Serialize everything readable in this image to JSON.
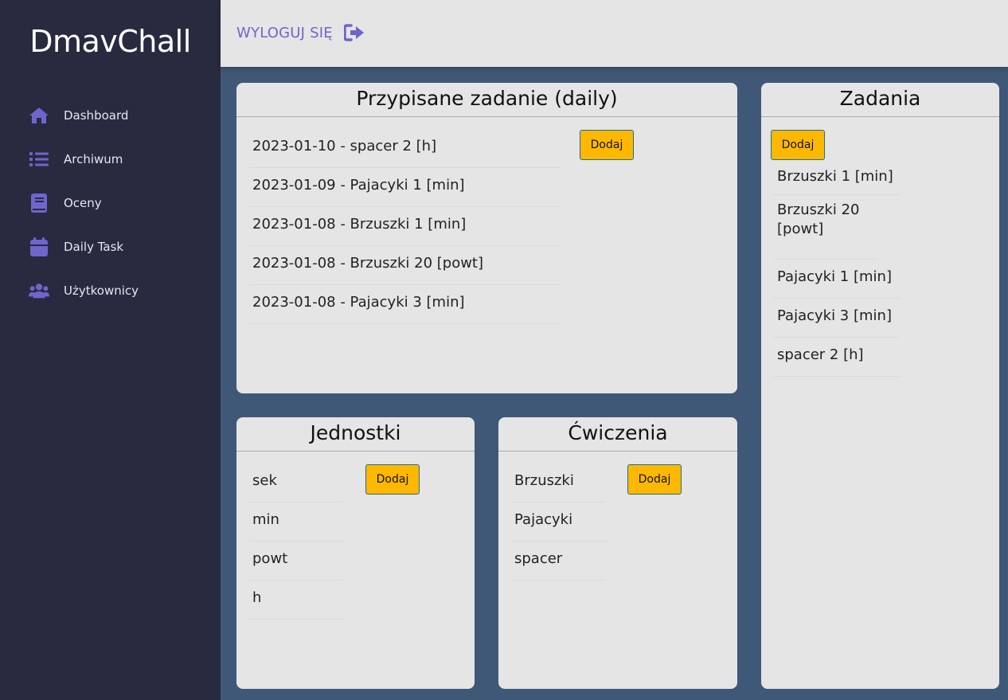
{
  "app": {
    "brand": "DmavChall"
  },
  "sidebar": {
    "items": [
      {
        "label": "Dashboard",
        "icon": "home-icon"
      },
      {
        "label": "Archiwum",
        "icon": "list-icon"
      },
      {
        "label": "Oceny",
        "icon": "book-icon"
      },
      {
        "label": "Daily Task",
        "icon": "calendar-icon"
      },
      {
        "label": "Użytkownicy",
        "icon": "users-icon"
      }
    ]
  },
  "topbar": {
    "logout_label": "WYLOGUJ SIĘ",
    "logout_icon": "sign-out-icon"
  },
  "daily": {
    "title": "Przypisane zadanie (daily)",
    "add_label": "Dodaj",
    "items": [
      "2023-01-10 - spacer 2 [h]",
      "2023-01-09 - Pajacyki 1 [min]",
      "2023-01-08 - Brzuszki 1 [min]",
      "2023-01-08 - Brzuszki 20 [powt]",
      "2023-01-08 - Pajacyki 3 [min]"
    ]
  },
  "tasks": {
    "title": "Zadania",
    "add_label": "Dodaj",
    "items": [
      "Brzuszki 1 [min]",
      "Brzuszki 20 [powt]",
      "Pajacyki 1 [min]",
      "Pajacyki 3 [min]",
      "spacer 2 [h]"
    ]
  },
  "units": {
    "title": "Jednostki",
    "add_label": "Dodaj",
    "items": [
      "sek",
      "min",
      "powt",
      "h"
    ]
  },
  "exercises": {
    "title": "Ćwiczenia",
    "add_label": "Dodaj",
    "items": [
      "Brzuszki",
      "Pajacyki",
      "spacer"
    ]
  },
  "colors": {
    "sidebar_bg": "#282a40",
    "main_bg": "#3f5878",
    "card_bg": "#e5e5e5",
    "accent": "#6f66cc",
    "button": "#ffb800"
  }
}
